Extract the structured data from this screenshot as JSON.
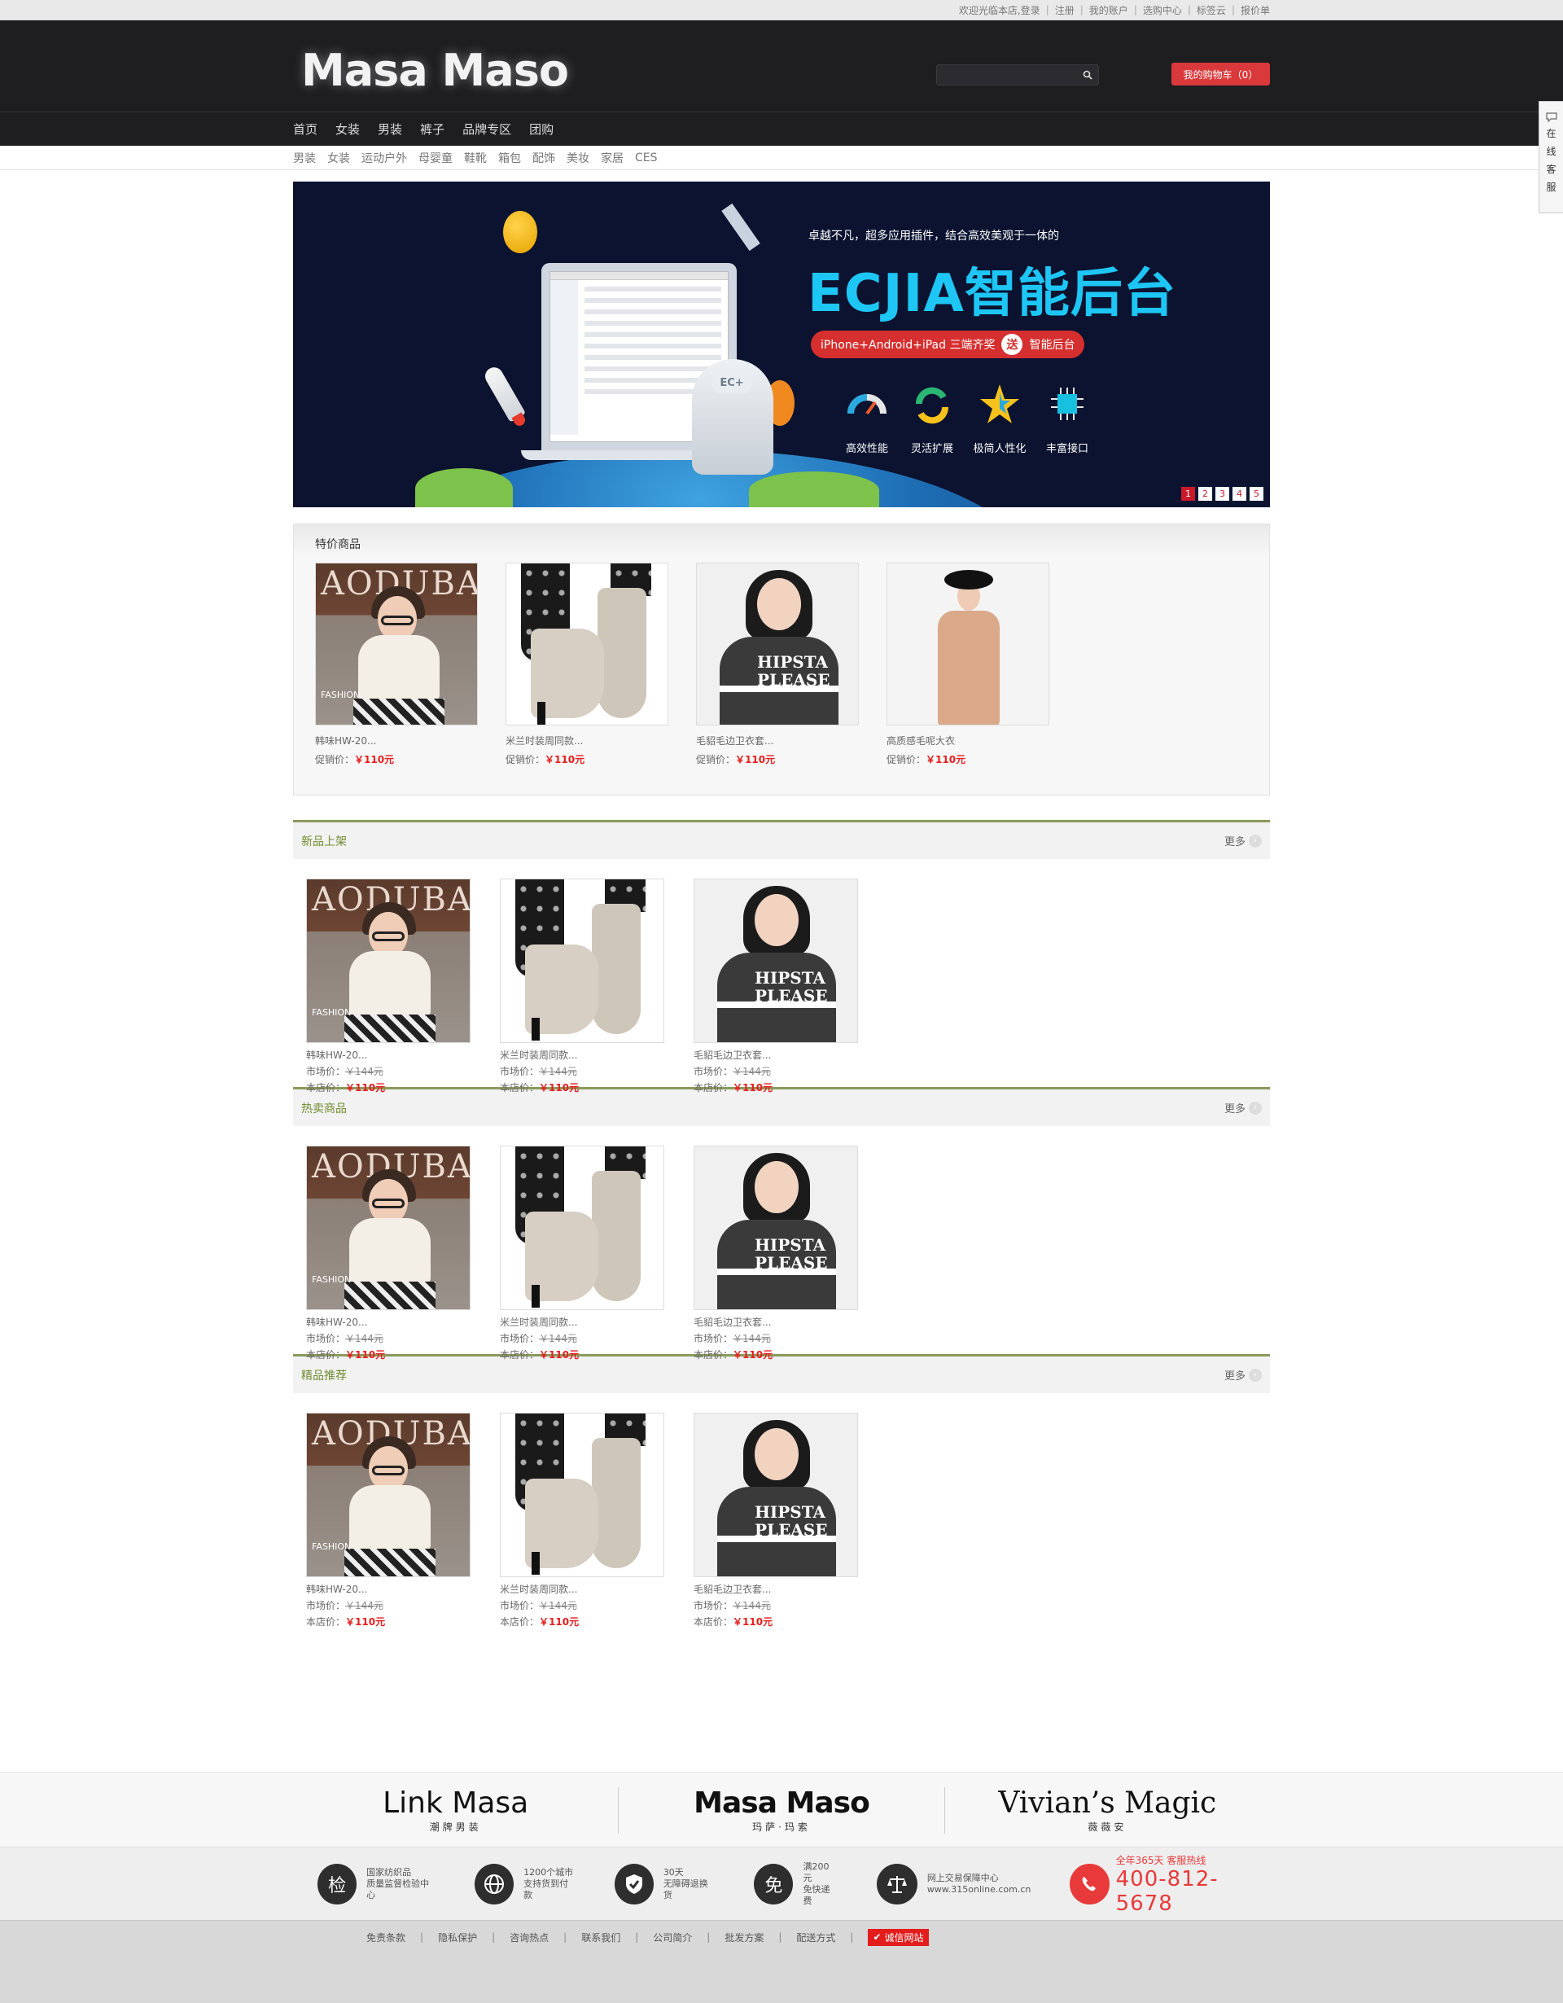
{
  "topbar": {
    "welcome": "欢迎光临本店,",
    "links": [
      "登录",
      "注册",
      "我的账户",
      "选购中心",
      "标签云",
      "报价单"
    ]
  },
  "header": {
    "logo": "Masa Maso",
    "search_placeholder": "",
    "cart_label": "我的购物车（0）"
  },
  "main_nav": [
    "首页",
    "女装",
    "男装",
    "裤子",
    "品牌专区",
    "团购"
  ],
  "sub_nav": [
    "男装",
    "女装",
    "运动户外",
    "母婴童",
    "鞋靴",
    "箱包",
    "配饰",
    "美妆",
    "家居",
    "CES"
  ],
  "banner": {
    "tagline": "卓越不凡，超多应用插件，结合高效美观于一体的",
    "title": "ECJIA智能后台",
    "pill_left": "iPhone+Android+iPad 三端齐奖",
    "pill_give": "送",
    "pill_right": "智能后台",
    "features": [
      "高效性能",
      "灵活扩展",
      "极简人性化",
      "丰富接口"
    ],
    "server_tag": "EC+",
    "pages": [
      "1",
      "2",
      "3",
      "4",
      "5"
    ],
    "active_page": "1"
  },
  "promo": {
    "title": "特价商品",
    "items": [
      {
        "name": "韩味HW-20...",
        "price_label": "促销价：",
        "price": "￥110元"
      },
      {
        "name": "米兰时装周同款...",
        "price_label": "促销价：",
        "price": "￥110元"
      },
      {
        "name": "毛貂毛边卫衣套...",
        "price_label": "促销价：",
        "price": "￥110元"
      },
      {
        "name": "高质感毛呢大衣",
        "price_label": "促销价：",
        "price": "￥110元"
      }
    ]
  },
  "sections": [
    {
      "title": "新品上架",
      "more": "更多",
      "items": [
        {
          "name": "韩味HW-20...",
          "market_label": "市场价：",
          "market": "￥144元",
          "shop_label": "本店价：",
          "shop": "￥110元"
        },
        {
          "name": "米兰时装周同款...",
          "market_label": "市场价：",
          "market": "￥144元",
          "shop_label": "本店价：",
          "shop": "￥110元"
        },
        {
          "name": "毛貂毛边卫衣套...",
          "market_label": "市场价：",
          "market": "￥144元",
          "shop_label": "本店价：",
          "shop": "￥110元"
        }
      ]
    },
    {
      "title": "热卖商品",
      "more": "更多",
      "items": [
        {
          "name": "韩味HW-20...",
          "market_label": "市场价：",
          "market": "￥144元",
          "shop_label": "本店价：",
          "shop": "￥110元"
        },
        {
          "name": "米兰时装周同款...",
          "market_label": "市场价：",
          "market": "￥144元",
          "shop_label": "本店价：",
          "shop": "￥110元"
        },
        {
          "name": "毛貂毛边卫衣套...",
          "market_label": "市场价：",
          "market": "￥144元",
          "shop_label": "本店价：",
          "shop": "￥110元"
        }
      ]
    },
    {
      "title": "精品推荐",
      "more": "更多",
      "items": [
        {
          "name": "韩味HW-20...",
          "market_label": "市场价：",
          "market": "￥144元",
          "shop_label": "本店价：",
          "shop": "￥110元"
        },
        {
          "name": "米兰时装周同款...",
          "market_label": "市场价：",
          "market": "￥144元",
          "shop_label": "本店价：",
          "shop": "￥110元"
        },
        {
          "name": "毛貂毛边卫衣套...",
          "market_label": "市场价：",
          "market": "￥144元",
          "shop_label": "本店价：",
          "shop": "￥110元"
        }
      ]
    }
  ],
  "brands": [
    {
      "name": "Link Masa",
      "sub": "潮牌男装"
    },
    {
      "name": "Masa Maso",
      "sub": "玛萨·玛索"
    },
    {
      "name": "Vivian’s Magic",
      "sub": "薇薇安"
    }
  ],
  "guarantees": [
    {
      "icon": "检",
      "line1": "国家纺织品",
      "line2": "质量监督检验中心"
    },
    {
      "icon": "globe-icon",
      "line1": "1200个城市",
      "line2": "支持货到付款"
    },
    {
      "icon": "shield-icon",
      "line1": "30天",
      "line2": "无障碍退换货"
    },
    {
      "icon": "免",
      "line1": "满200元",
      "line2": "免快递费"
    },
    {
      "icon": "scale-icon",
      "line1": "网上交易保障中心",
      "line2": "www.315online.com.cn"
    }
  ],
  "hotline": {
    "label": "全年365天 客服热线",
    "number": "400-812-5678"
  },
  "footer_links": [
    "免责条款",
    "隐私保护",
    "咨询热点",
    "联系我们",
    "公司简介",
    "批发方案",
    "配送方式"
  ],
  "trust_badge": "诚信网站",
  "service_tab": [
    "在",
    "线",
    "客",
    "服"
  ],
  "colors": {
    "accent_red": "#e61d1d",
    "section_green": "#6f8c2f",
    "header_dark": "#1e1e21",
    "cart_red": "#d9393b"
  }
}
